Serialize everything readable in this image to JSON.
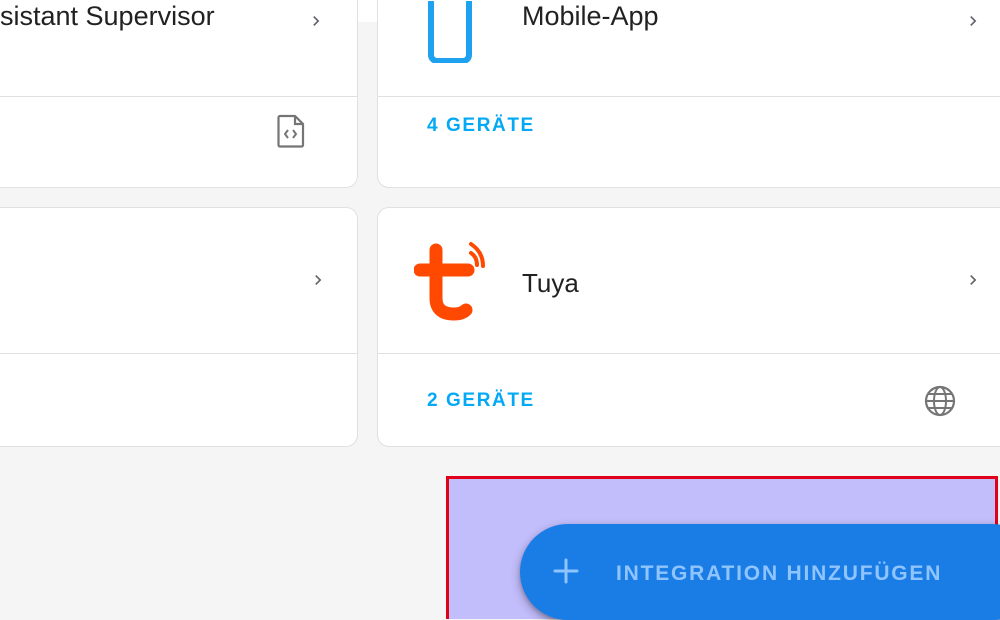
{
  "cards": {
    "supervisor": {
      "title": "sistant Supervisor",
      "chevron_icon": "chevron-right-icon",
      "footer_icon": "file-code-icon"
    },
    "mobile_app": {
      "title": "Mobile-App",
      "icon": "mobile-app-logo",
      "chevron_icon": "chevron-right-icon",
      "devices_label": "4 GERÄTE"
    },
    "left_lower": {
      "chevron_icon": "chevron-right-icon"
    },
    "tuya": {
      "title": "Tuya",
      "icon": "tuya-logo",
      "chevron_icon": "chevron-right-icon",
      "devices_label": "2 GERÄTE",
      "footer_icon": "globe-icon"
    }
  },
  "fab": {
    "label": "INTEGRATION HINZUFÜGEN",
    "icon": "plus-icon"
  },
  "colors": {
    "accent": "#03a9f4",
    "fab_background": "#1a7de6",
    "highlight_fill": "#c2bdfb",
    "highlight_border": "#e0001a",
    "tuya_brand": "#ff4800"
  }
}
